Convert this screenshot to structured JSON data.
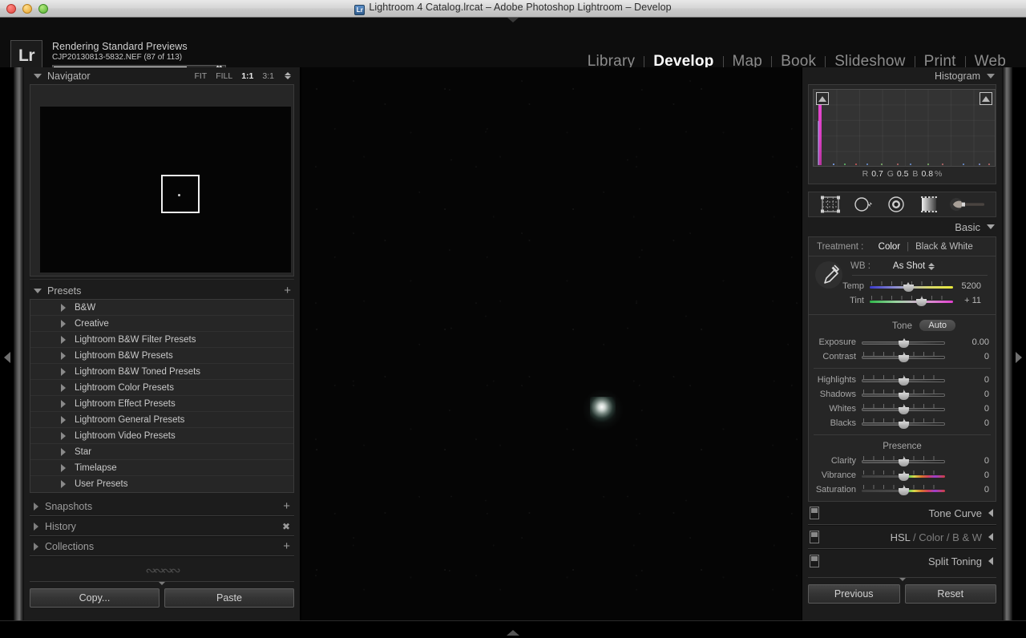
{
  "window": {
    "title": "Lightroom 4 Catalog.lrcat – Adobe Photoshop Lightroom – Develop",
    "app_icon": "lightroom-app-icon",
    "icon_text": "Lr"
  },
  "identity": {
    "logo_text": "Lr",
    "activity_title": "Rendering Standard Previews",
    "activity_subtitle": "CJP20130813-5832.NEF (87 of 113)",
    "progress_percent": 77,
    "cancel_icon": "✖"
  },
  "modules": [
    {
      "label": "Library",
      "active": false
    },
    {
      "label": "Develop",
      "active": true
    },
    {
      "label": "Map",
      "active": false
    },
    {
      "label": "Book",
      "active": false
    },
    {
      "label": "Slideshow",
      "active": false
    },
    {
      "label": "Print",
      "active": false
    },
    {
      "label": "Web",
      "active": false
    }
  ],
  "left_panel": {
    "navigator": {
      "title": "Navigator",
      "zoom_levels": [
        {
          "label": "FIT",
          "active": false
        },
        {
          "label": "FILL",
          "active": false
        },
        {
          "label": "1:1",
          "active": true
        },
        {
          "label": "3:1",
          "active": false
        }
      ]
    },
    "presets": {
      "title": "Presets",
      "add_label": "+",
      "items": [
        "B&W",
        "Creative",
        "Lightroom B&W Filter Presets",
        "Lightroom B&W Presets",
        "Lightroom B&W Toned Presets",
        "Lightroom Color Presets",
        "Lightroom Effect Presets",
        "Lightroom General Presets",
        "Lightroom Video Presets",
        "Star",
        "Timelapse",
        "User Presets"
      ]
    },
    "collapsed": [
      {
        "title": "Snapshots",
        "action": "+"
      },
      {
        "title": "History",
        "action": "✖"
      },
      {
        "title": "Collections",
        "action": "+"
      }
    ],
    "buttons": {
      "copy": "Copy...",
      "paste": "Paste"
    }
  },
  "right_panel": {
    "histogram": {
      "title": "Histogram",
      "r_label": "R",
      "r_value": "0.7",
      "g_label": "G",
      "g_value": "0.5",
      "b_label": "B",
      "b_value": "0.8",
      "unit": "%"
    },
    "tools": [
      {
        "name": "crop-overlay-tool",
        "active": false
      },
      {
        "name": "spot-removal-tool",
        "active": false
      },
      {
        "name": "red-eye-correction-tool",
        "active": false
      },
      {
        "name": "graduated-filter-tool",
        "active": false
      },
      {
        "name": "adjustment-brush-tool",
        "active": false
      }
    ],
    "basic": {
      "title": "Basic",
      "treatment_label": "Treatment :",
      "treatment_color": "Color",
      "treatment_bw": "Black & White",
      "treatment_selected": "Color",
      "wb_label": "WB :",
      "wb_value": "As Shot",
      "eyedropper_icon": "white-balance-selector-icon",
      "wb_sliders": [
        {
          "label": "Temp",
          "value": "5200",
          "pos": 46,
          "style": "temp"
        },
        {
          "label": "Tint",
          "value": "+ 11",
          "pos": 62,
          "style": "tint"
        }
      ],
      "tone_label": "Tone",
      "auto_label": "Auto",
      "tone_sliders": [
        {
          "label": "Exposure",
          "value": "0.00",
          "pos": 50,
          "style": "grey",
          "ticks": false
        },
        {
          "label": "Contrast",
          "value": "0",
          "pos": 50,
          "style": "grey",
          "ticks": true
        },
        {
          "label": "Highlights",
          "value": "0",
          "pos": 50,
          "style": "grey",
          "ticks": true
        },
        {
          "label": "Shadows",
          "value": "0",
          "pos": 50,
          "style": "grey",
          "ticks": true
        },
        {
          "label": "Whites",
          "value": "0",
          "pos": 50,
          "style": "grey",
          "ticks": true
        },
        {
          "label": "Blacks",
          "value": "0",
          "pos": 50,
          "style": "grey",
          "ticks": true
        }
      ],
      "presence_label": "Presence",
      "presence_sliders": [
        {
          "label": "Clarity",
          "value": "0",
          "pos": 50,
          "style": "grey",
          "ticks": true
        },
        {
          "label": "Vibrance",
          "value": "0",
          "pos": 50,
          "style": "rainbow",
          "ticks": true
        },
        {
          "label": "Saturation",
          "value": "0",
          "pos": 50,
          "style": "rainbow",
          "ticks": true
        }
      ]
    },
    "collapsed_sections": [
      {
        "title": "Tone Curve",
        "dim_parts": ""
      },
      {
        "title": "HSL",
        "dim_parts": " /  Color  /  B & W"
      },
      {
        "title": "Split Toning",
        "dim_parts": ""
      }
    ],
    "buttons": {
      "previous": "Previous",
      "reset": "Reset"
    }
  },
  "colors": {
    "panel_bg": "#1c1c1c",
    "panel_inner": "#262626",
    "accent_text": "#ffffff",
    "histogram_spike": "#e84ad2"
  }
}
